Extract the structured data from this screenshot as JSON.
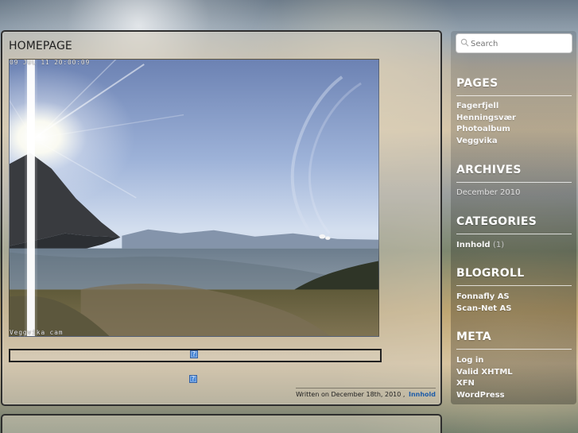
{
  "main": {
    "title": "HOMEPAGE",
    "webcam": {
      "timestamp": "09 JUL 11 20:00:09",
      "caption": "Veggvika cam"
    },
    "meta": {
      "written_text": "Written on December 18th, 2010 ,",
      "category_link": "Innhold"
    }
  },
  "sidebar": {
    "search": {
      "placeholder": "Search"
    },
    "pages": {
      "title": "PAGES",
      "items": [
        "Fagerfjell",
        "Henningsvær",
        "Photoalbum",
        "Veggvika"
      ]
    },
    "archives": {
      "title": "ARCHIVES",
      "items": [
        "December 2010"
      ]
    },
    "categories": {
      "title": "CATEGORIES",
      "items": [
        {
          "label": "Innhold",
          "count": "(1)"
        }
      ]
    },
    "blogroll": {
      "title": "BLOGROLL",
      "items": [
        "Fonnafly AS",
        "Scan-Net AS"
      ]
    },
    "meta": {
      "title": "META",
      "items": [
        "Log in",
        "Valid XHTML",
        "XFN",
        "WordPress"
      ]
    }
  },
  "icons": {
    "search": "search-icon",
    "help": "help-icon"
  },
  "colors": {
    "panel_border": "#2e2e2e",
    "sidebar_text": "#ffffff",
    "link_blue": "#1f5da8",
    "help_blue": "#4b88d6"
  }
}
